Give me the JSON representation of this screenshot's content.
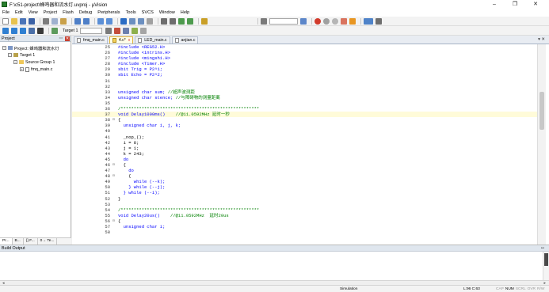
{
  "window": {
    "title": "F:\\c51-project\\蜂鸣器和流水灯.uvproj - µVision",
    "minimize_glyph": "–",
    "maximize_glyph": "❐",
    "close_glyph": "✕"
  },
  "menu": [
    "File",
    "Edit",
    "View",
    "Project",
    "Flash",
    "Debug",
    "Peripherals",
    "Tools",
    "SVCS",
    "Window",
    "Help"
  ],
  "toolbar": {
    "target_label": "Target 1"
  },
  "project_panel": {
    "title": "Project",
    "pin_glyph": "ꟷ",
    "close_glyph": "✕",
    "tree": {
      "project_label": "Project: 蜂鸣器和流水灯",
      "target_label": "Target 1",
      "group_label": "Source Group 1",
      "file_label": "fmq_main.c"
    },
    "tabs": [
      "Pr...",
      "B...",
      "{} F...",
      "0→ Te..."
    ]
  },
  "editor": {
    "tabs": [
      {
        "label": "fmq_main.c",
        "active": false,
        "modified": false
      },
      {
        "label": "4.c*",
        "active": true,
        "modified": true
      },
      {
        "label": "LED_main.c",
        "active": false,
        "modified": false
      },
      {
        "label": "anjian.c",
        "active": false,
        "modified": false
      }
    ],
    "tab_close_glyph": "x",
    "tab_strip_controls": "▾ ✕",
    "lines": [
      {
        "n": "25",
        "fold": "",
        "text": "#include <REG52.H>"
      },
      {
        "n": "26",
        "fold": "",
        "text": "#include <intrins.H>"
      },
      {
        "n": "27",
        "fold": "",
        "text": "#include <mingshi.H>"
      },
      {
        "n": "28",
        "fold": "",
        "text": "#include <Timer.H>"
      },
      {
        "n": "29",
        "fold": "",
        "text": "sbit Trig = P2^1;"
      },
      {
        "n": "30",
        "fold": "",
        "text": "sbit Echo = P2^2;"
      },
      {
        "n": "31",
        "fold": "",
        "text": ""
      },
      {
        "n": "32",
        "fold": "",
        "text": ""
      },
      {
        "n": "33",
        "fold": "",
        "text": "unsigned char sum; //超声波测距"
      },
      {
        "n": "34",
        "fold": "",
        "text": "unsigned char stence; //与障碍物的测量距离"
      },
      {
        "n": "35",
        "fold": "",
        "text": ""
      },
      {
        "n": "36",
        "fold": "",
        "text": "/*****************************************************"
      },
      {
        "n": "37",
        "fold": "",
        "text": "void Delay1000ms()    //@11.0592MHz 延时一秒"
      },
      {
        "n": "38",
        "fold": "⊟",
        "text": "{"
      },
      {
        "n": "39",
        "fold": "",
        "text": "  unsigned char i, j, k;"
      },
      {
        "n": "40",
        "fold": "",
        "text": ""
      },
      {
        "n": "41",
        "fold": "",
        "text": "  _nop_();"
      },
      {
        "n": "42",
        "fold": "",
        "text": "  i = 8;"
      },
      {
        "n": "43",
        "fold": "",
        "text": "  j = 1;"
      },
      {
        "n": "44",
        "fold": "",
        "text": "  k = 243;"
      },
      {
        "n": "45",
        "fold": "",
        "text": "  do"
      },
      {
        "n": "46",
        "fold": "⊟",
        "text": "  {"
      },
      {
        "n": "47",
        "fold": "",
        "text": "    do"
      },
      {
        "n": "48",
        "fold": "⊟",
        "text": "    {"
      },
      {
        "n": "49",
        "fold": "",
        "text": "      while (--k);"
      },
      {
        "n": "50",
        "fold": "",
        "text": "    } while (--j);"
      },
      {
        "n": "51",
        "fold": "",
        "text": "  } while (--i);"
      },
      {
        "n": "52",
        "fold": "",
        "text": "}"
      },
      {
        "n": "53",
        "fold": "",
        "text": ""
      },
      {
        "n": "54",
        "fold": "",
        "text": "/*****************************************************"
      },
      {
        "n": "55",
        "fold": "",
        "text": "void Delay20us()    //@11.0592MHz  延时20us"
      },
      {
        "n": "56",
        "fold": "⊟",
        "text": "{"
      },
      {
        "n": "57",
        "fold": "",
        "text": "  unsigned char i;"
      },
      {
        "n": "58",
        "fold": "",
        "text": ""
      }
    ],
    "current_line": "37",
    "colors": {
      "keyword": "#0000ff",
      "comment": "#008000",
      "string": "#a31515",
      "normal": "#000000"
    }
  },
  "build_output": {
    "title": "Build Output",
    "pin_glyph": "ꟷ",
    "scroll_left_glyph": "◂",
    "scroll_right_glyph": "▸"
  },
  "status": {
    "mode": "Simulation",
    "position": "L:96 C:63",
    "flags": [
      {
        "label": "CAP",
        "on": false
      },
      {
        "label": "NUM",
        "on": true
      },
      {
        "label": "SCRL",
        "on": false
      },
      {
        "label": "OVR",
        "on": false
      },
      {
        "label": "R/W",
        "on": false
      }
    ]
  }
}
